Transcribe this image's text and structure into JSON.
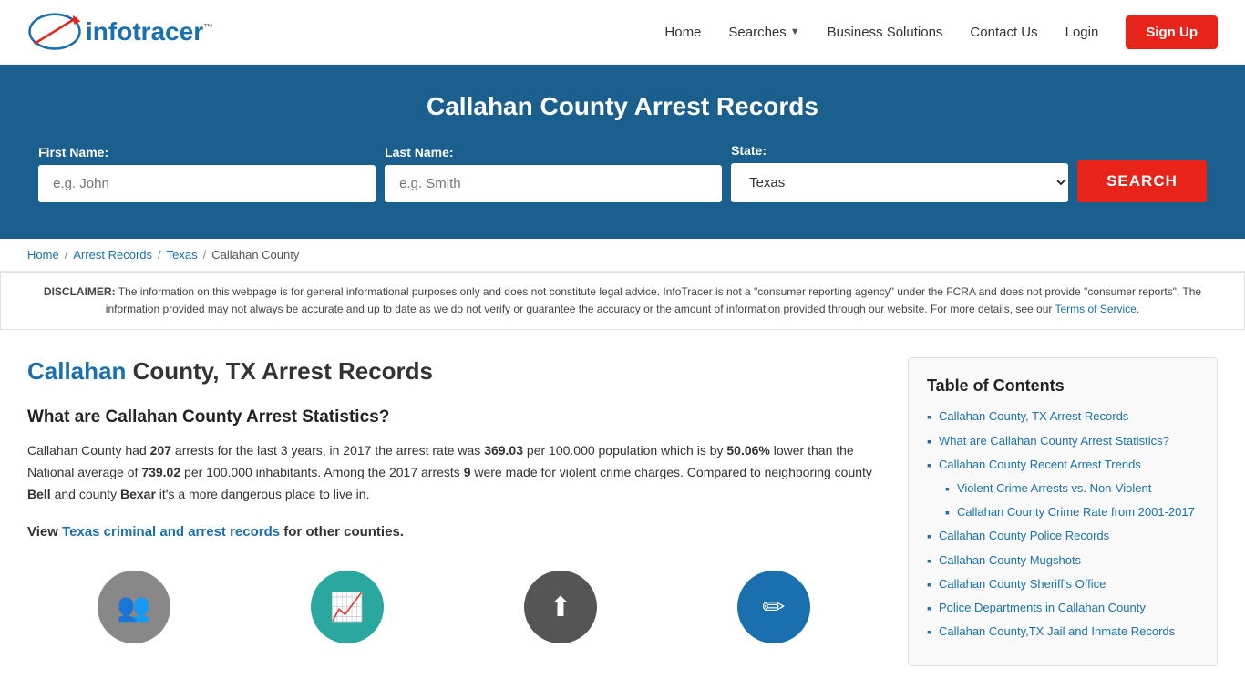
{
  "site": {
    "logo_info": "info",
    "logo_tracer": "tracer",
    "logo_tm": "™"
  },
  "nav": {
    "home_label": "Home",
    "searches_label": "Searches",
    "business_solutions_label": "Business Solutions",
    "contact_us_label": "Contact Us",
    "login_label": "Login",
    "signup_label": "Sign Up"
  },
  "hero": {
    "title": "Callahan County Arrest Records",
    "first_name_label": "First Name:",
    "first_name_placeholder": "e.g. John",
    "last_name_label": "Last Name:",
    "last_name_placeholder": "e.g. Smith",
    "state_label": "State:",
    "state_value": "Texas",
    "search_button": "SEARCH"
  },
  "breadcrumb": {
    "home": "Home",
    "arrest_records": "Arrest Records",
    "texas": "Texas",
    "callahan_county": "Callahan County"
  },
  "disclaimer": {
    "label": "DISCLAIMER:",
    "text": "The information on this webpage is for general informational purposes only and does not constitute legal advice. InfoTracer is not a \"consumer reporting agency\" under the FCRA and does not provide \"consumer reports\". The information provided may not always be accurate and up to date as we do not verify or guarantee the accuracy or the amount of information provided through our website. For more details, see our",
    "tos_link": "Terms of Service",
    "period": "."
  },
  "content": {
    "main_heading_highlight": "Callahan",
    "main_heading_rest": " County, TX Arrest Records",
    "stats_heading": "What are Callahan County Arrest Statistics?",
    "stats_p1_pre": "Callahan County had ",
    "arrests_count": "207",
    "stats_p1_mid": " arrests for the last 3 years, in 2017 the arrest rate was ",
    "arrest_rate": "369.03",
    "stats_p1_mid2": " per 100.000 population which is by ",
    "lower_pct": "50.06%",
    "stats_p1_mid3": " lower than the National average of ",
    "national_avg": "739.02",
    "stats_p1_mid4": " per 100.000 inhabitants. Among the 2017 arrests ",
    "violent_count": "9",
    "stats_p1_end": " were made for violent crime charges. Compared to neighboring county ",
    "county1": "Bell",
    "stats_p1_end2": " and county ",
    "county2": "Bexar",
    "stats_p1_end3": " it's a more dangerous place to live in.",
    "view_line_pre": "View ",
    "view_link_text": "Texas criminal and arrest records",
    "view_line_post": " for other counties."
  },
  "toc": {
    "heading": "Table of Contents",
    "items": [
      {
        "text": "Callahan County, TX Arrest Records",
        "sub": false
      },
      {
        "text": "What are Callahan County Arrest Statistics?",
        "sub": false
      },
      {
        "text": "Callahan County Recent Arrest Trends",
        "sub": false
      },
      {
        "text": "Violent Crime Arrests vs. Non-Violent",
        "sub": true
      },
      {
        "text": "Callahan County Crime Rate from 2001-2017",
        "sub": true
      },
      {
        "text": "Callahan County Police Records",
        "sub": false
      },
      {
        "text": "Callahan County Mugshots",
        "sub": false
      },
      {
        "text": "Callahan County Sheriff's Office",
        "sub": false
      },
      {
        "text": "Police Departments in Callahan County",
        "sub": false
      },
      {
        "text": "Callahan County,TX Jail and Inmate Records",
        "sub": false
      }
    ]
  },
  "icons": [
    {
      "symbol": "👤",
      "bg": "gray"
    },
    {
      "symbol": "📈",
      "bg": "teal"
    },
    {
      "symbol": "⬆",
      "bg": "dark"
    },
    {
      "symbol": "✏",
      "bg": "blue"
    }
  ]
}
